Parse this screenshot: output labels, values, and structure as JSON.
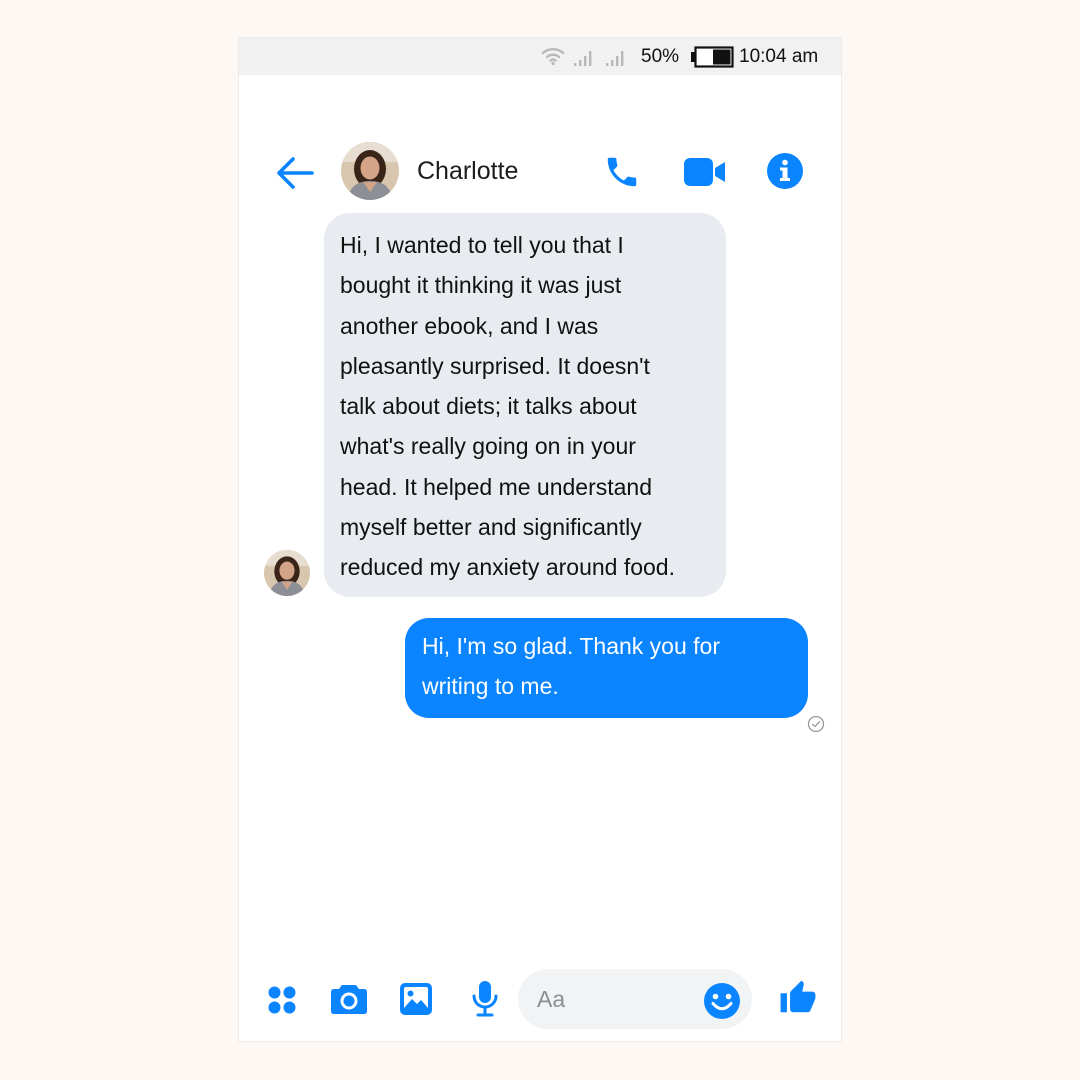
{
  "status_bar": {
    "wifi_icon": "wifi-icon",
    "signal_icon": "cellular-signal-icon",
    "battery_percent": "50%",
    "battery_icon": "battery-icon",
    "time": "10:04 am"
  },
  "header": {
    "back_icon": "arrow-left-icon",
    "contact_name": "Charlotte",
    "call_icon": "phone-icon",
    "video_icon": "video-camera-icon",
    "info_icon": "info-icon"
  },
  "messages": [
    {
      "direction": "incoming",
      "text": "Hi, I wanted to tell you that I\nbought it thinking it was just\nanother ebook, and I was\npleasantly surprised. It doesn't\ntalk about diets; it talks about\nwhat's really going on in your\nhead. It helped me understand\nmyself better and significantly\nreduced my anxiety around food."
    },
    {
      "direction": "outgoing",
      "text": "Hi, I'm so glad. Thank you for\nwriting to me.",
      "receipt_icon": "sent-check-icon"
    }
  ],
  "composer": {
    "placeholder": "Aa",
    "value": "",
    "icons": [
      "apps-icon",
      "camera-icon",
      "gallery-icon",
      "microphone-icon",
      "emoji-icon",
      "thumbs-up-icon"
    ]
  },
  "colors": {
    "accent": "#0a84ff",
    "incoming_bubble": "#e8ecf0",
    "status_bar": "#f1f1f1",
    "page_background": "#fdf8f4"
  }
}
